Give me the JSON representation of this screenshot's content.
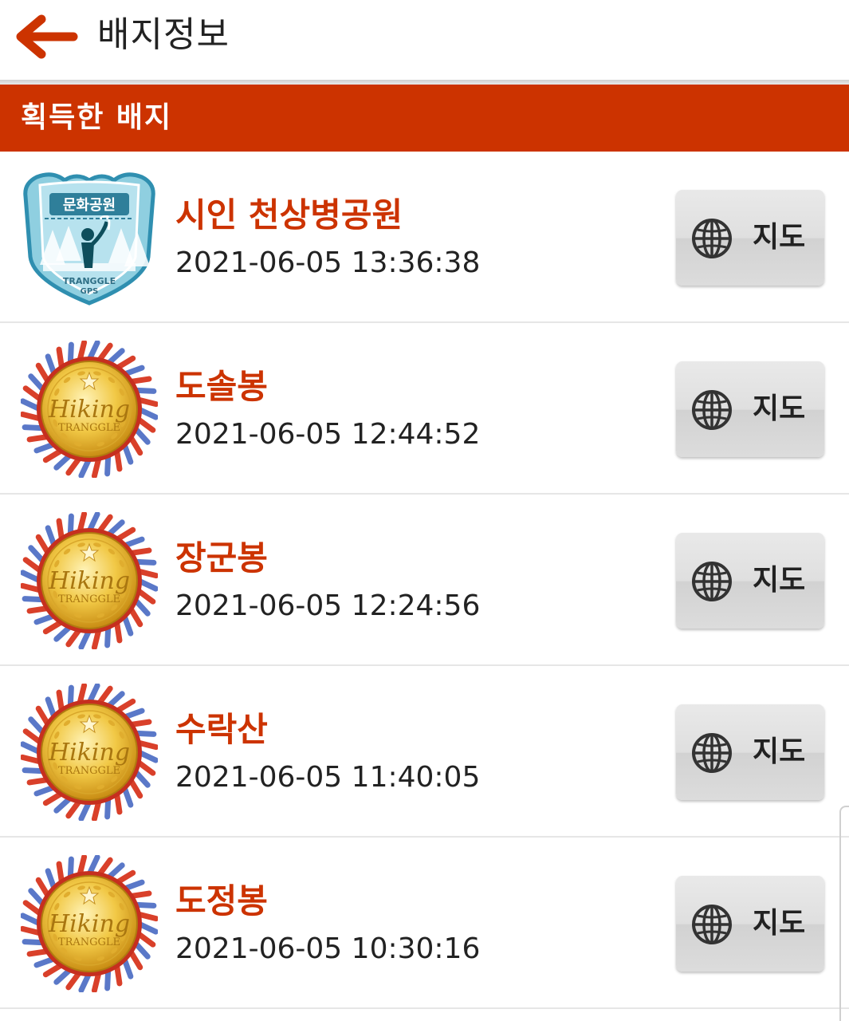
{
  "header": {
    "title": "배지정보",
    "back_icon": "back-arrow-icon",
    "accent": "#cc3300"
  },
  "section": {
    "title": "획득한 배지"
  },
  "badges": [
    {
      "name": "시인 천상병공원",
      "time": "2021-06-05 13:36:38",
      "badge_type": "park",
      "badge_category": "문화공원",
      "badge_brand": "TRANGGLE",
      "badge_brand2": "GPS",
      "map_label": "지도"
    },
    {
      "name": "도솔봉",
      "time": "2021-06-05 12:44:52",
      "badge_type": "hiking",
      "badge_brand": "Hiking",
      "badge_brand2": "TRANGGLE",
      "map_label": "지도"
    },
    {
      "name": "장군봉",
      "time": "2021-06-05 12:24:56",
      "badge_type": "hiking",
      "badge_brand": "Hiking",
      "badge_brand2": "TRANGGLE",
      "map_label": "지도"
    },
    {
      "name": "수락산",
      "time": "2021-06-05 11:40:05",
      "badge_type": "hiking",
      "badge_brand": "Hiking",
      "badge_brand2": "TRANGGLE",
      "map_label": "지도"
    },
    {
      "name": "도정봉",
      "time": "2021-06-05 10:30:16",
      "badge_type": "hiking",
      "badge_brand": "Hiking",
      "badge_brand2": "TRANGGLE",
      "map_label": "지도"
    }
  ]
}
